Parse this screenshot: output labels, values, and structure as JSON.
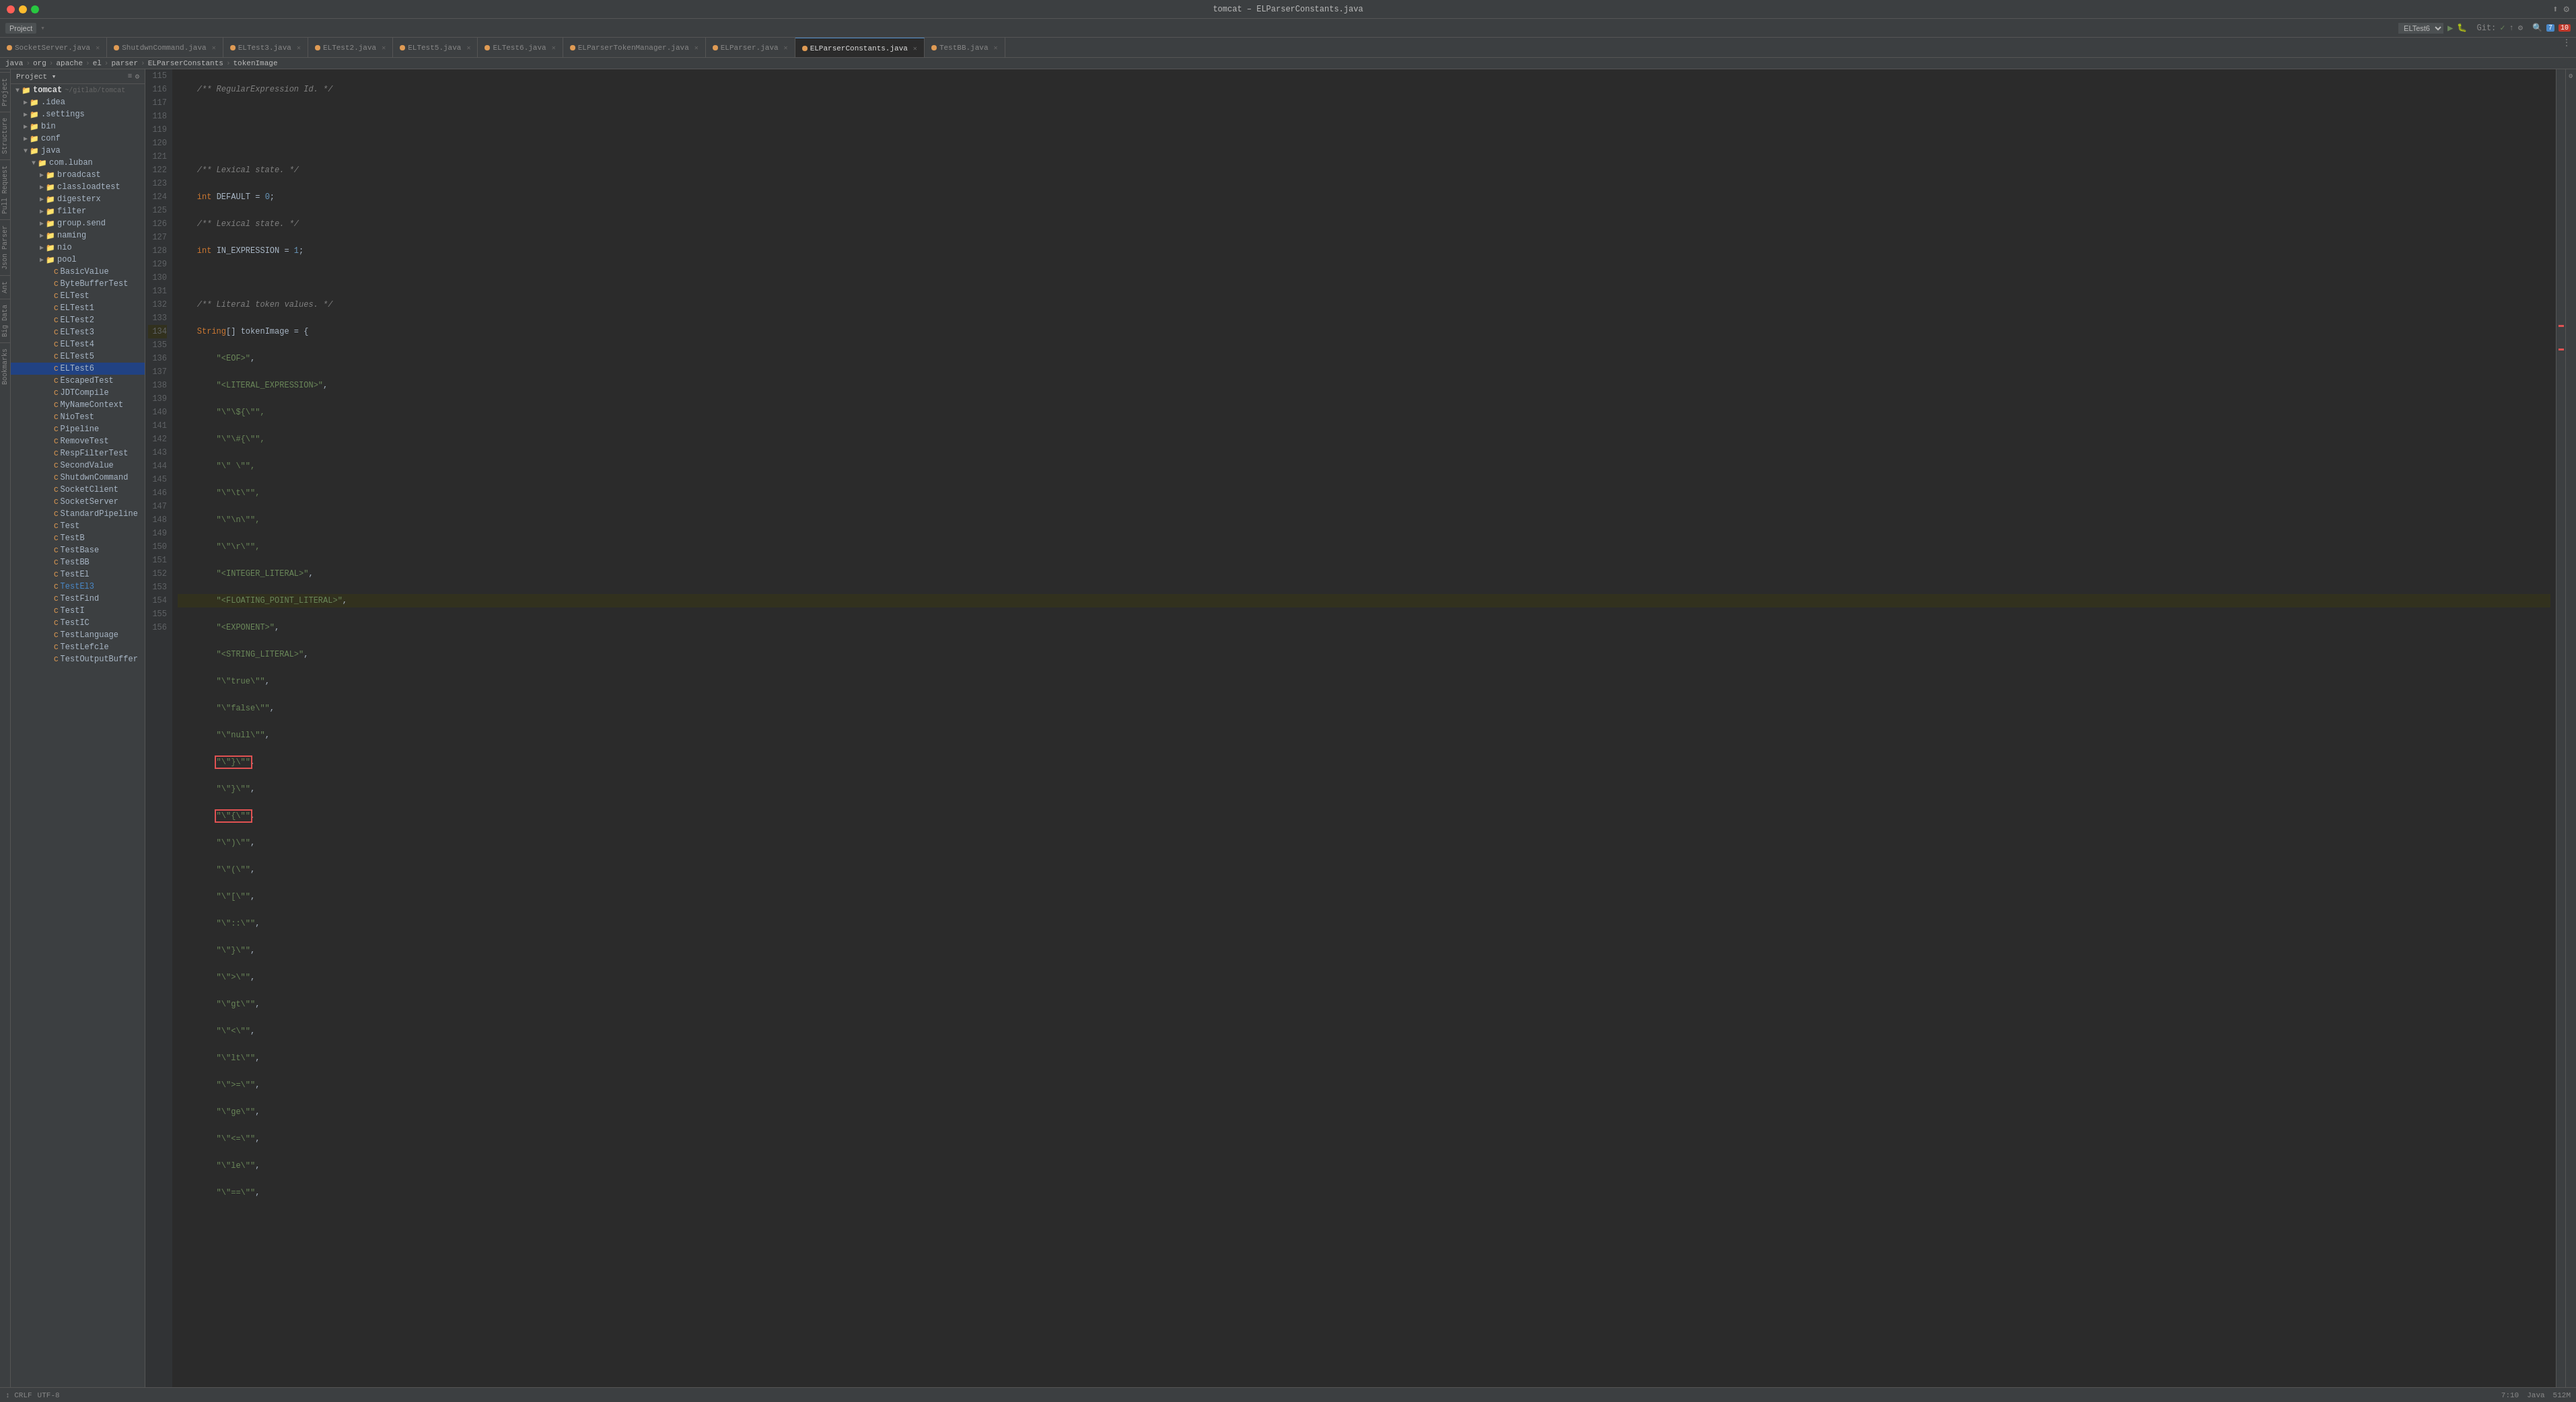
{
  "titleBar": {
    "title": "tomcat – ELParserConstants.java",
    "buttons": [
      "close",
      "minimize",
      "maximize"
    ]
  },
  "toolbar": {
    "projectLabel": "Project",
    "runConfig": "ELTest6",
    "gitLabel": "Git:",
    "badge": "7",
    "badge2": "10"
  },
  "tabs": [
    {
      "label": "SocketServer.java",
      "icon": "orange",
      "active": false
    },
    {
      "label": "ShutdwnCommand.java",
      "icon": "orange",
      "active": false
    },
    {
      "label": "ELTest3.java",
      "icon": "orange",
      "active": false
    },
    {
      "label": "ELTest2.java",
      "icon": "orange",
      "active": false
    },
    {
      "label": "ELTest5.java",
      "icon": "orange",
      "active": false
    },
    {
      "label": "ELTest6.java",
      "icon": "orange",
      "active": false
    },
    {
      "label": "ELParserTokenManager.java",
      "icon": "orange",
      "active": false
    },
    {
      "label": "ELParser.java",
      "icon": "orange",
      "active": false
    },
    {
      "label": "ELParserConstants.java",
      "icon": "orange",
      "active": true
    },
    {
      "label": "TestBB.java",
      "icon": "orange",
      "active": false
    }
  ],
  "navbar": {
    "items": [
      "java",
      "org",
      "apache",
      "el",
      "parser",
      "ELParserConstants",
      "tokenImage"
    ]
  },
  "fileTree": {
    "projectLabel": "Project",
    "rootItem": "tomcat",
    "rootPath": "~/gitlab/tomcat",
    "items": [
      {
        "label": ".idea",
        "depth": 1,
        "type": "folder",
        "expanded": false
      },
      {
        "label": ".settings",
        "depth": 1,
        "type": "folder",
        "expanded": false
      },
      {
        "label": "bin",
        "depth": 1,
        "type": "folder",
        "expanded": false
      },
      {
        "label": "conf",
        "depth": 1,
        "type": "folder",
        "expanded": false
      },
      {
        "label": "java",
        "depth": 1,
        "type": "folder",
        "expanded": true
      },
      {
        "label": "com.luban",
        "depth": 2,
        "type": "folder",
        "expanded": true
      },
      {
        "label": "broadcast",
        "depth": 3,
        "type": "folder",
        "expanded": false
      },
      {
        "label": "classloadtest",
        "depth": 3,
        "type": "folder",
        "expanded": false
      },
      {
        "label": "digesterx",
        "depth": 3,
        "type": "folder",
        "expanded": false
      },
      {
        "label": "filter",
        "depth": 3,
        "type": "folder",
        "expanded": false
      },
      {
        "label": "group.send",
        "depth": 3,
        "type": "folder",
        "expanded": false
      },
      {
        "label": "naming",
        "depth": 3,
        "type": "folder",
        "expanded": false
      },
      {
        "label": "nio",
        "depth": 3,
        "type": "folder",
        "expanded": false
      },
      {
        "label": "pool",
        "depth": 3,
        "type": "folder",
        "expanded": false
      },
      {
        "label": "BasicValue",
        "depth": 3,
        "type": "class"
      },
      {
        "label": "ByteBufferTest",
        "depth": 3,
        "type": "class"
      },
      {
        "label": "ELTest",
        "depth": 3,
        "type": "class"
      },
      {
        "label": "ELTest1",
        "depth": 3,
        "type": "class"
      },
      {
        "label": "ELTest2",
        "depth": 3,
        "type": "class"
      },
      {
        "label": "ELTest3",
        "depth": 3,
        "type": "class"
      },
      {
        "label": "ELTest4",
        "depth": 3,
        "type": "class"
      },
      {
        "label": "ELTest5",
        "depth": 3,
        "type": "class"
      },
      {
        "label": "ELTest6",
        "depth": 3,
        "type": "class",
        "selected": true
      },
      {
        "label": "EscapedTest",
        "depth": 3,
        "type": "class"
      },
      {
        "label": "JDTCompile",
        "depth": 3,
        "type": "class"
      },
      {
        "label": "MyNameContext",
        "depth": 3,
        "type": "class"
      },
      {
        "label": "NioTest",
        "depth": 3,
        "type": "class"
      },
      {
        "label": "Pipeline",
        "depth": 3,
        "type": "class"
      },
      {
        "label": "RemoveTest",
        "depth": 3,
        "type": "class"
      },
      {
        "label": "RespFilterTest",
        "depth": 3,
        "type": "class"
      },
      {
        "label": "SecondValue",
        "depth": 3,
        "type": "class"
      },
      {
        "label": "ShutdwnCommand",
        "depth": 3,
        "type": "class"
      },
      {
        "label": "SocketClient",
        "depth": 3,
        "type": "class"
      },
      {
        "label": "SocketServer",
        "depth": 3,
        "type": "class"
      },
      {
        "label": "StandardPipeline",
        "depth": 3,
        "type": "class"
      },
      {
        "label": "Test",
        "depth": 3,
        "type": "class"
      },
      {
        "label": "TestB",
        "depth": 3,
        "type": "class"
      },
      {
        "label": "TestBase",
        "depth": 3,
        "type": "class"
      },
      {
        "label": "TestBB",
        "depth": 3,
        "type": "class"
      },
      {
        "label": "TestEl",
        "depth": 3,
        "type": "class"
      },
      {
        "label": "TestEl3",
        "depth": 3,
        "type": "class",
        "selected": false
      },
      {
        "label": "TestFind",
        "depth": 3,
        "type": "class"
      },
      {
        "label": "TestI",
        "depth": 3,
        "type": "class"
      },
      {
        "label": "TestIC",
        "depth": 3,
        "type": "class"
      },
      {
        "label": "TestLanguage",
        "depth": 3,
        "type": "class"
      },
      {
        "label": "TestLefcle",
        "depth": 3,
        "type": "class"
      },
      {
        "label": "TestOutputBuffer",
        "depth": 3,
        "type": "class"
      }
    ]
  },
  "codeLines": [
    {
      "num": 115,
      "content": "    /** RegularExpression Id. */",
      "type": "comment"
    },
    {
      "num": 116,
      "content": "",
      "type": "blank"
    },
    {
      "num": 117,
      "content": "",
      "type": "blank"
    },
    {
      "num": 118,
      "content": "    /** Lexical state. */",
      "type": "comment"
    },
    {
      "num": 119,
      "content": "    int DEFAULT = 0;",
      "type": "code"
    },
    {
      "num": 120,
      "content": "    /** Lexical state. */",
      "type": "comment"
    },
    {
      "num": 121,
      "content": "    int IN_EXPRESSION = 1;",
      "type": "code"
    },
    {
      "num": 122,
      "content": "",
      "type": "blank"
    },
    {
      "num": 123,
      "content": "    /** Literal token values. */",
      "type": "comment"
    },
    {
      "num": 124,
      "content": "    String[] tokenImage = {",
      "type": "code"
    },
    {
      "num": 125,
      "content": "        \"<EOF>\",",
      "type": "str-line"
    },
    {
      "num": 126,
      "content": "        \"<LITERAL_EXPRESSION>\",",
      "type": "str-line"
    },
    {
      "num": 127,
      "content": "        \"\\\"${\\\"\"",
      "type": "str-line"
    },
    {
      "num": 128,
      "content": "        \"\\\"#{\\\"\"",
      "type": "str-line"
    },
    {
      "num": 129,
      "content": "        \"\\\" \\\"\"",
      "type": "str-line"
    },
    {
      "num": 130,
      "content": "        \"\\\"\\\\t\\\"\"",
      "type": "str-line"
    },
    {
      "num": 131,
      "content": "        \"\\\"\\\\n\\\"\"",
      "type": "str-line"
    },
    {
      "num": 132,
      "content": "        \"\\\"\\\\r\\\"\"",
      "type": "str-line"
    },
    {
      "num": 133,
      "content": "        \"<INTEGER_LITERAL>\",",
      "type": "str-line"
    },
    {
      "num": 134,
      "content": "        \"<FLOATING_POINT_LITERAL>\",",
      "type": "str-line",
      "highlighted": true,
      "cursor": true
    },
    {
      "num": 135,
      "content": "        \"<EXPONENT>\",",
      "type": "str-line"
    },
    {
      "num": 136,
      "content": "        \"<STRING_LITERAL>\",",
      "type": "str-line"
    },
    {
      "num": 137,
      "content": "        \"\\\"true\\\"\",",
      "type": "str-line"
    },
    {
      "num": 138,
      "content": "        \"\\\"false\\\"\",",
      "type": "str-line"
    },
    {
      "num": 139,
      "content": "        \"\\\"null\\\"\",",
      "type": "str-line"
    },
    {
      "num": 140,
      "content": "        \"\\\"}\\\"\"",
      "type": "str-line",
      "redbox": true
    },
    {
      "num": 141,
      "content": "        \"\\\",\\\"\"",
      "type": "str-line"
    },
    {
      "num": 142,
      "content": "        \"\\\"{\\\"\"",
      "type": "str-line",
      "redbox": true
    },
    {
      "num": 143,
      "content": "        \"\\\")\\\"\"",
      "type": "str-line"
    },
    {
      "num": 144,
      "content": "        \"\\\"(\\\"\"",
      "type": "str-line"
    },
    {
      "num": 145,
      "content": "        \"\\\"[\\\"\"",
      "type": "str-line"
    },
    {
      "num": 146,
      "content": "        \"\\\"::\\\"\"",
      "type": "str-line"
    },
    {
      "num": 147,
      "content": "        \"\\\",\\\"\"",
      "type": "str-line"
    },
    {
      "num": 148,
      "content": "        \"\\\">\\\"\"",
      "type": "str-line"
    },
    {
      "num": 149,
      "content": "        \"\\\"gt\\\"\"",
      "type": "str-line"
    },
    {
      "num": 150,
      "content": "        \"\\\"<\\\"\"",
      "type": "str-line"
    },
    {
      "num": 151,
      "content": "        \"\\\"lt\\\"\"",
      "type": "str-line"
    },
    {
      "num": 152,
      "content": "        \"\\\">\\u003d\\\"\"",
      "type": "str-line"
    },
    {
      "num": 153,
      "content": "        \"\\\"ge\\\"\"",
      "type": "str-line"
    },
    {
      "num": 154,
      "content": "        \"\\\"<=\\\"\"",
      "type": "str-line"
    },
    {
      "num": 155,
      "content": "        \"\\\"le\\\"\"",
      "type": "str-line"
    },
    {
      "num": 156,
      "content": "        \"\\\"==\\\"\"",
      "type": "str-line"
    }
  ],
  "statusBar": {
    "left": "↕ CRLF",
    "encoding": "UTF-8",
    "lineCol": "7:10",
    "language": "Java",
    "memory": "512M"
  }
}
